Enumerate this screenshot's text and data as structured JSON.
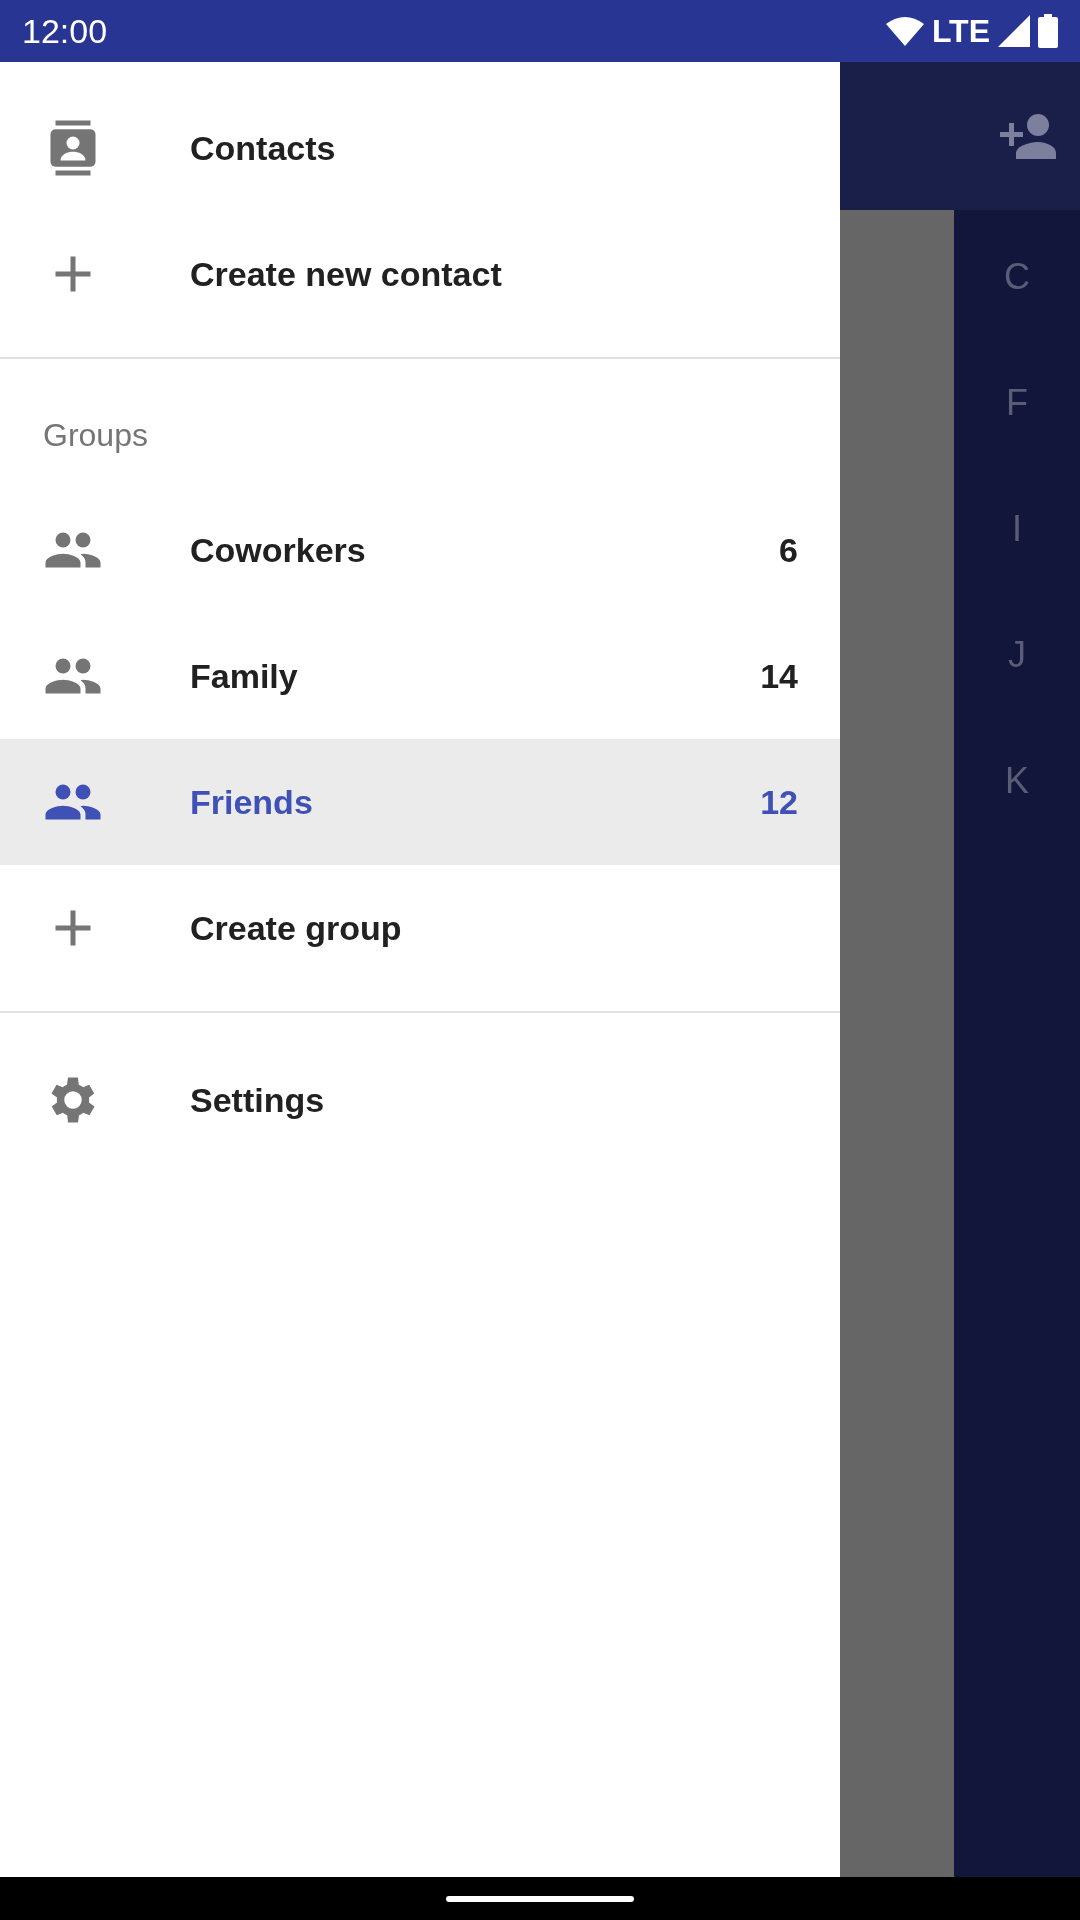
{
  "status_bar": {
    "time": "12:00",
    "network": "LTE"
  },
  "drawer": {
    "items": [
      {
        "kind": "app",
        "label": "Contacts"
      },
      {
        "kind": "create",
        "label": "Create new contact"
      },
      {
        "kind": "divider"
      },
      {
        "kind": "section",
        "label": "Groups"
      },
      {
        "kind": "group",
        "label": "Coworkers",
        "count": "6",
        "selected": false
      },
      {
        "kind": "group",
        "label": "Family",
        "count": "14",
        "selected": false
      },
      {
        "kind": "group",
        "label": "Friends",
        "count": "12",
        "selected": true
      },
      {
        "kind": "create",
        "label": "Create group"
      },
      {
        "kind": "divider"
      },
      {
        "kind": "settings",
        "label": "Settings"
      }
    ]
  },
  "background": {
    "index_letters": [
      "C",
      "F",
      "I",
      "J",
      "K"
    ]
  }
}
